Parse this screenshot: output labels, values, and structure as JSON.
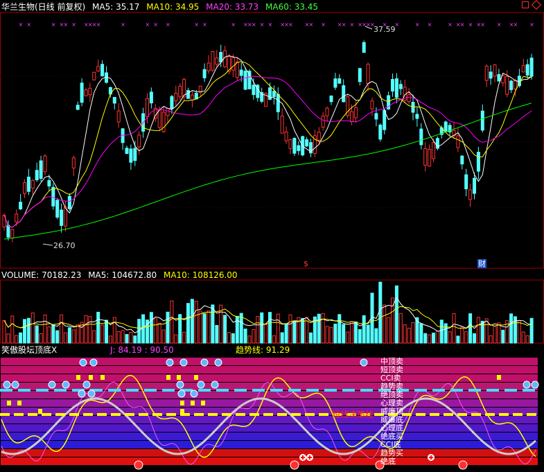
{
  "colors": {
    "bg": "#000000",
    "up": "#ff3232",
    "down": "#54ffff",
    "ma5": "#ffffff",
    "ma10": "#ffff00",
    "ma20": "#ff00ff",
    "ma60": "#00ff00",
    "divider": "#a00000",
    "panel_band_a": "#c01068",
    "panel_band_b": "#1c20d8",
    "trend": "#ffff00"
  },
  "price_header": {
    "title": "华兰生物(日线 前复权)",
    "ma5": "MA5: 35.17",
    "ma10": "MA10: 34.95",
    "ma20": "MA20: 33.73",
    "ma60": "MA60: 33.45"
  },
  "price_annotations": {
    "high": "37.59",
    "low": "26.70",
    "event_s": "$",
    "event_cai": "财"
  },
  "volume_header": {
    "volume": "VOLUME: 70182.23",
    "ma5": "MA5: 104672.80",
    "ma10": "MA10: 108126.00"
  },
  "indicator_header": {
    "name": "笑傲股坛顶底X",
    "j_value": "J: 84.19 : 90.50",
    "trend_label": "趋势线: 91.29"
  },
  "indicator_labels": [
    "中顶卖",
    "短顶卖",
    "CCI卖",
    "趋势卖",
    "绝顶卖",
    "心理卖",
    "威廉顶",
    "威廉底",
    "心理底",
    "绝底买",
    "CCI底",
    "趋势买",
    "绝底"
  ],
  "indicator_inline_label": "短线决策线",
  "icons": {
    "price_markers": "magenta-x-marker",
    "blue_balls": "blue-ball-icon",
    "red_balls": "red-ball-icon",
    "cross_marks": "red-cross-icon"
  }
}
